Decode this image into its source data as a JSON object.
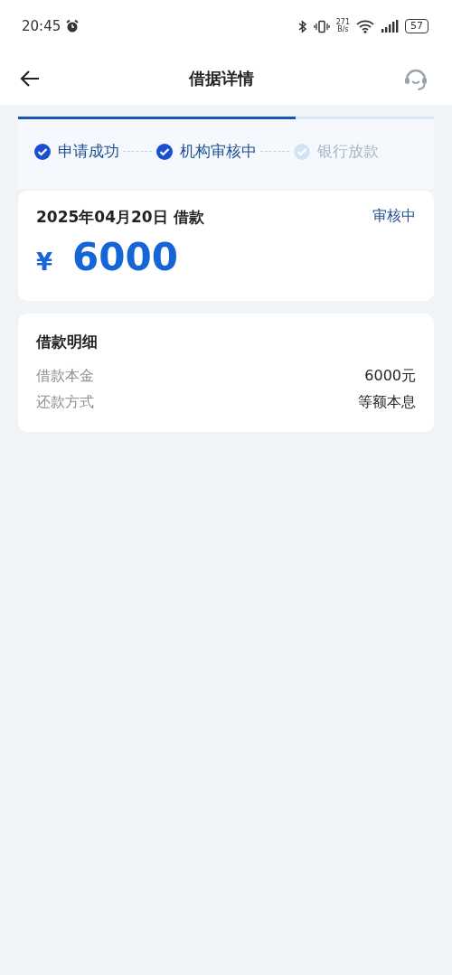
{
  "status_bar": {
    "time": "20:45",
    "speed_value": "271",
    "speed_unit": "B/s",
    "battery": "57"
  },
  "nav": {
    "title": "借据详情"
  },
  "progress": {
    "level": 0.667,
    "steps": [
      {
        "label": "申请成功",
        "done": true
      },
      {
        "label": "机构审核中",
        "done": true
      },
      {
        "label": "银行放款",
        "done": false
      }
    ]
  },
  "loan": {
    "date": "2025年04月20日 借款",
    "status": "审核中",
    "currency": "¥",
    "amount": "6000"
  },
  "details": {
    "title": "借款明细",
    "rows": [
      {
        "label": "借款本金",
        "value": "6000元"
      },
      {
        "label": "还款方式",
        "value": "等额本息"
      }
    ]
  }
}
